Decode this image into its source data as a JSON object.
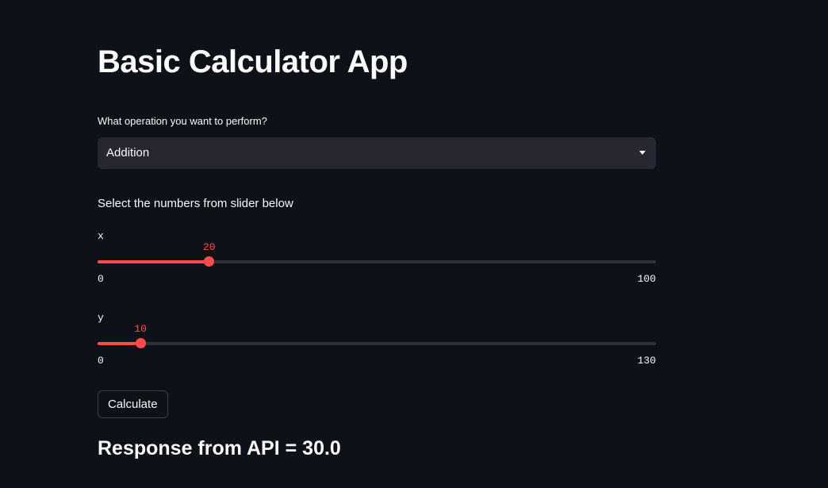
{
  "app": {
    "title": "Basic Calculator App"
  },
  "operation_select": {
    "label": "What operation you want to perform?",
    "selected": "Addition"
  },
  "instructions": "Select the numbers from slider below",
  "sliders": [
    {
      "label": "x",
      "value": 20,
      "min": 0,
      "max": 100
    },
    {
      "label": "y",
      "value": 10,
      "min": 0,
      "max": 130
    }
  ],
  "calculate_button": {
    "label": "Calculate"
  },
  "result": {
    "text": "Response from API = 30.0"
  },
  "colors": {
    "background": "#0e1117",
    "accent": "#ff4b4b",
    "input_bg": "#262730",
    "text": "#fafafa"
  },
  "icons": {
    "select_chevron": "chevron-down-icon"
  }
}
